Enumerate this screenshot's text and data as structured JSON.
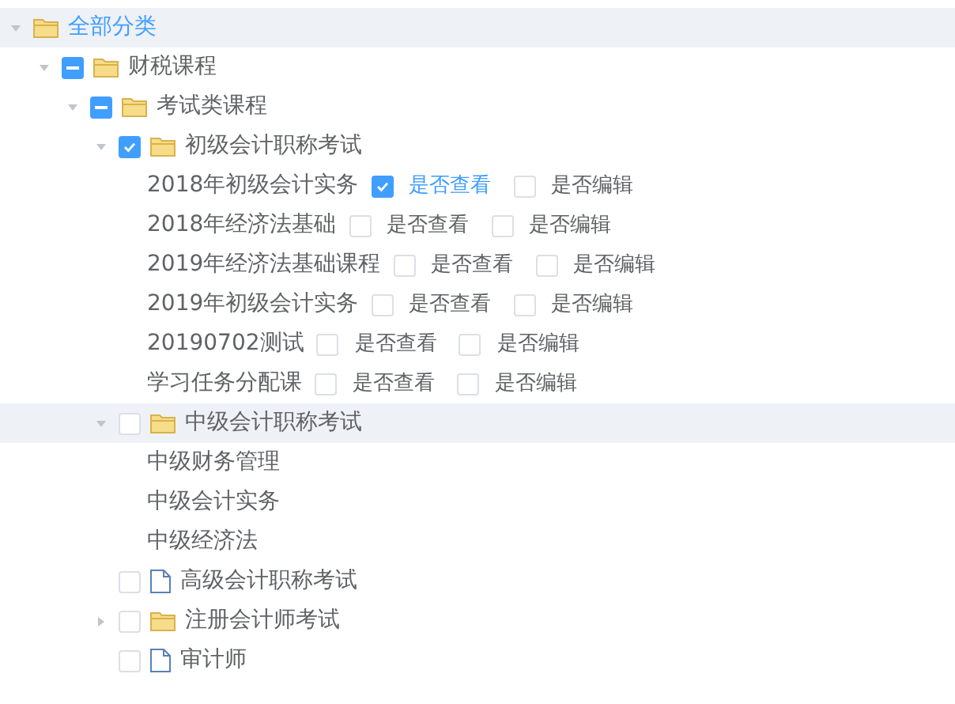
{
  "tree": [
    {
      "kind": "root",
      "label": "全部分类",
      "selected": true,
      "hovered": true,
      "expanded": true,
      "children": [
        {
          "kind": "folder",
          "label": "财税课程",
          "selected": false,
          "hovered": false,
          "expanded": true,
          "checked": true,
          "indeterminate": true,
          "children": [
            {
              "kind": "folder",
              "label": "考试类课程",
              "selected": false,
              "hovered": false,
              "expanded": true,
              "checked": true,
              "indeterminate": true,
              "children": [
                {
                  "kind": "folder",
                  "label": "初级会计职称考试",
                  "selected": false,
                  "hovered": false,
                  "expanded": true,
                  "checked": true,
                  "indeterminate": false,
                  "children": [
                    {
                      "kind": "course",
                      "label": "2018年初级会计实务",
                      "permissions": [
                        {
                          "label": "是否查看",
                          "checked": true
                        },
                        {
                          "label": "是否编辑",
                          "checked": false
                        }
                      ]
                    },
                    {
                      "kind": "course",
                      "label": "2018年经济法基础",
                      "permissions": [
                        {
                          "label": "是否查看",
                          "checked": false
                        },
                        {
                          "label": "是否编辑",
                          "checked": false
                        }
                      ]
                    },
                    {
                      "kind": "course",
                      "label": "2019年经济法基础课程",
                      "permissions": [
                        {
                          "label": "是否查看",
                          "checked": false
                        },
                        {
                          "label": "是否编辑",
                          "checked": false
                        }
                      ]
                    },
                    {
                      "kind": "course",
                      "label": "2019年初级会计实务",
                      "permissions": [
                        {
                          "label": "是否查看",
                          "checked": false
                        },
                        {
                          "label": "是否编辑",
                          "checked": false
                        }
                      ]
                    },
                    {
                      "kind": "course",
                      "label": "20190702测试",
                      "permissions": [
                        {
                          "label": "是否查看",
                          "checked": false
                        },
                        {
                          "label": "是否编辑",
                          "checked": false
                        }
                      ]
                    },
                    {
                      "kind": "course",
                      "label": "学习任务分配课",
                      "permissions": [
                        {
                          "label": "是否查看",
                          "checked": false
                        },
                        {
                          "label": "是否编辑",
                          "checked": false
                        }
                      ]
                    }
                  ]
                },
                {
                  "kind": "folder",
                  "label": "中级会计职称考试",
                  "selected": false,
                  "hovered": true,
                  "expanded": true,
                  "checked": false,
                  "indeterminate": false,
                  "children": [
                    {
                      "kind": "item",
                      "label": "中级财务管理"
                    },
                    {
                      "kind": "item",
                      "label": "中级会计实务"
                    },
                    {
                      "kind": "item",
                      "label": "中级经济法"
                    }
                  ]
                },
                {
                  "kind": "file",
                  "label": "高级会计职称考试",
                  "selected": false,
                  "hovered": false,
                  "checked": false,
                  "indeterminate": false
                },
                {
                  "kind": "folder",
                  "label": "注册会计师考试",
                  "selected": false,
                  "hovered": false,
                  "expanded": false,
                  "checked": false,
                  "indeterminate": false
                },
                {
                  "kind": "file",
                  "label": "审计师",
                  "selected": false,
                  "hovered": false,
                  "checked": false,
                  "indeterminate": false
                }
              ]
            }
          ]
        }
      ]
    }
  ]
}
